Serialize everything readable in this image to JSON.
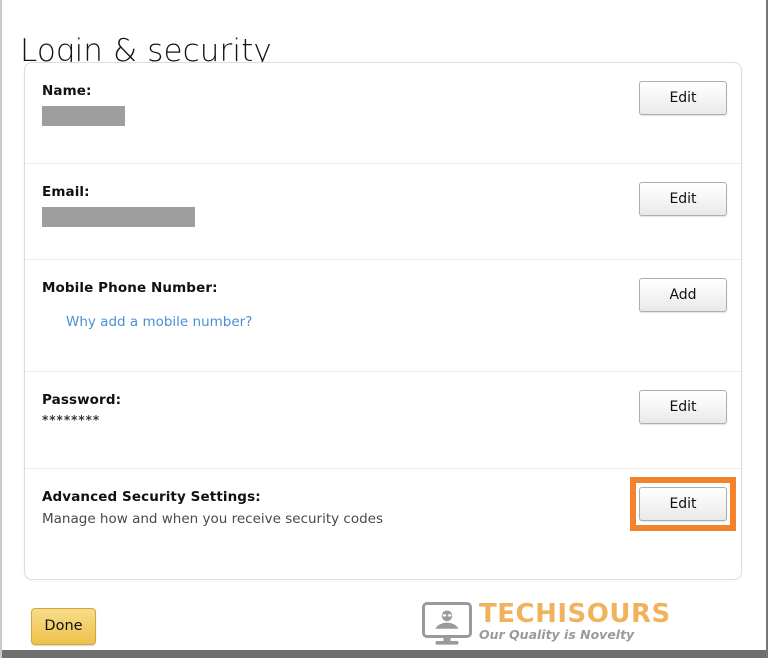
{
  "page": {
    "title": "Login & security"
  },
  "card": {
    "rows": [
      {
        "key": "name",
        "label": "Name:",
        "value_redacted": true,
        "action_label": "Edit",
        "highlighted": false
      },
      {
        "key": "email",
        "label": "Email:",
        "value_redacted": true,
        "action_label": "Edit",
        "highlighted": false
      },
      {
        "key": "mobile",
        "label": "Mobile Phone Number:",
        "link_text": "Why add a mobile number?",
        "action_label": "Add",
        "highlighted": false
      },
      {
        "key": "password",
        "label": "Password:",
        "masked_value": "********",
        "action_label": "Edit",
        "highlighted": false
      },
      {
        "key": "advanced_security",
        "label": "Advanced Security Settings:",
        "description": "Manage how and when you receive security codes",
        "action_label": "Edit",
        "highlighted": true
      }
    ]
  },
  "footer": {
    "done_label": "Done"
  },
  "watermark": {
    "name": "TECHISOURS",
    "tagline": "Our Quality is Novelty",
    "icon": "monitor-person-icon"
  },
  "colors": {
    "highlight_orange": "#f5832b",
    "link_blue": "#4a8fd6",
    "redaction_gray": "#9e9e9e",
    "done_yellow": "#f3cf6a",
    "logo_orange": "#f0b35c",
    "logo_gray": "#9a9a9a"
  }
}
